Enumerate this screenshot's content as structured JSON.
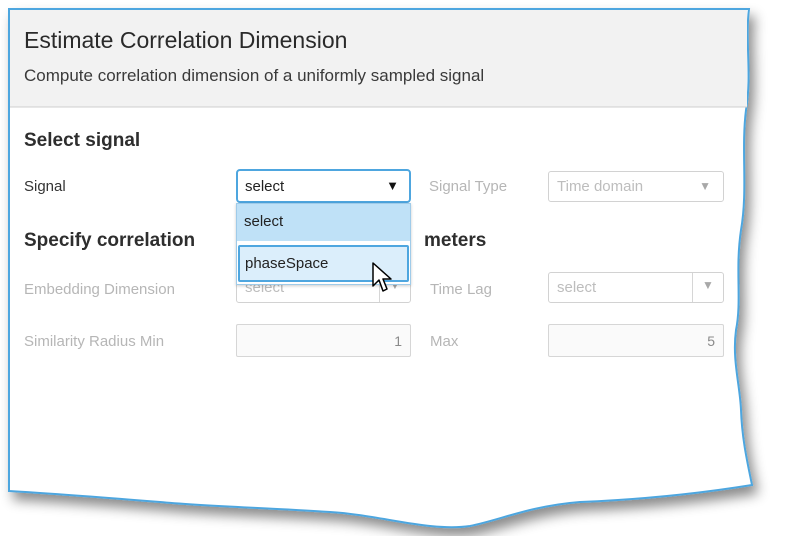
{
  "header": {
    "title": "Estimate Correlation Dimension",
    "subtitle": "Compute correlation dimension of a uniformly sampled signal"
  },
  "select_signal": {
    "heading": "Select signal",
    "signal_label": "Signal",
    "signal_value": "select",
    "signal_type_label": "Signal Type",
    "signal_type_value": "Time domain"
  },
  "dropdown": {
    "options": [
      "select",
      "phaseSpace"
    ],
    "selected": "select",
    "hovered": "phaseSpace"
  },
  "params": {
    "heading_left": "Specify correlation",
    "heading_right": "meters",
    "embedding_label": "Embedding Dimension",
    "embedding_value": "select",
    "time_lag_label": "Time Lag",
    "time_lag_value": "select",
    "radius_min_label": "Similarity Radius Min",
    "radius_min_value": "1",
    "max_label": "Max",
    "max_value": "5"
  },
  "colors": {
    "accent": "#4ea6df",
    "dropdown_selected_bg": "#bfe1f7",
    "dropdown_hover_bg": "#dbeefb"
  },
  "icons": {
    "dropdown_arrow": "chevron-down-icon",
    "cursor": "mouse-pointer-icon"
  }
}
